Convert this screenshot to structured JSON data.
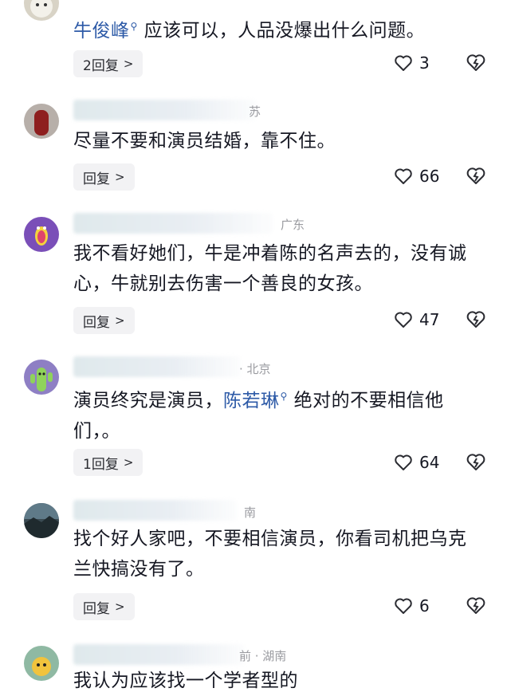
{
  "comments": [
    {
      "mention": "牛俊峰",
      "text_after": "应该可以，人品没爆出什么问题。",
      "reply_label": "2回复",
      "likes": "3",
      "avatar_icon": "avatar-white-cat-icon"
    },
    {
      "location_partial": "苏",
      "text": "尽量不要和演员结婚，靠不住。",
      "reply_label": "回复",
      "likes": "66",
      "avatar_icon": "avatar-red-figure-icon"
    },
    {
      "location_partial": "广东",
      "text": "我不看好她们，牛是冲着陈的名声去的，没有诚心，牛就别去伤害一个善良的女孩。",
      "reply_label": "回复",
      "likes": "47",
      "avatar_icon": "avatar-purple-monster-icon"
    },
    {
      "location_partial": "· 北京",
      "text_before": "演员终究是演员，",
      "mention": "陈若琳",
      "text_after": "绝对的不要相信他们，。",
      "reply_label": "1回复",
      "likes": "64",
      "avatar_icon": "avatar-cactus-icon"
    },
    {
      "location_partial": "南",
      "text": "找个好人家吧，不要相信演员，你看司机把乌克兰快搞没有了。",
      "reply_label": "回复",
      "likes": "6",
      "avatar_icon": "avatar-dark-landscape-icon"
    },
    {
      "location_partial": "前 · 湖南",
      "text": "我认为应该找一个学者型的",
      "avatar_icon": "avatar-cartoon-icon"
    }
  ],
  "colors": {
    "mention": "#2d5aa7",
    "text": "#161823",
    "secondary": "#9a9ba0"
  }
}
